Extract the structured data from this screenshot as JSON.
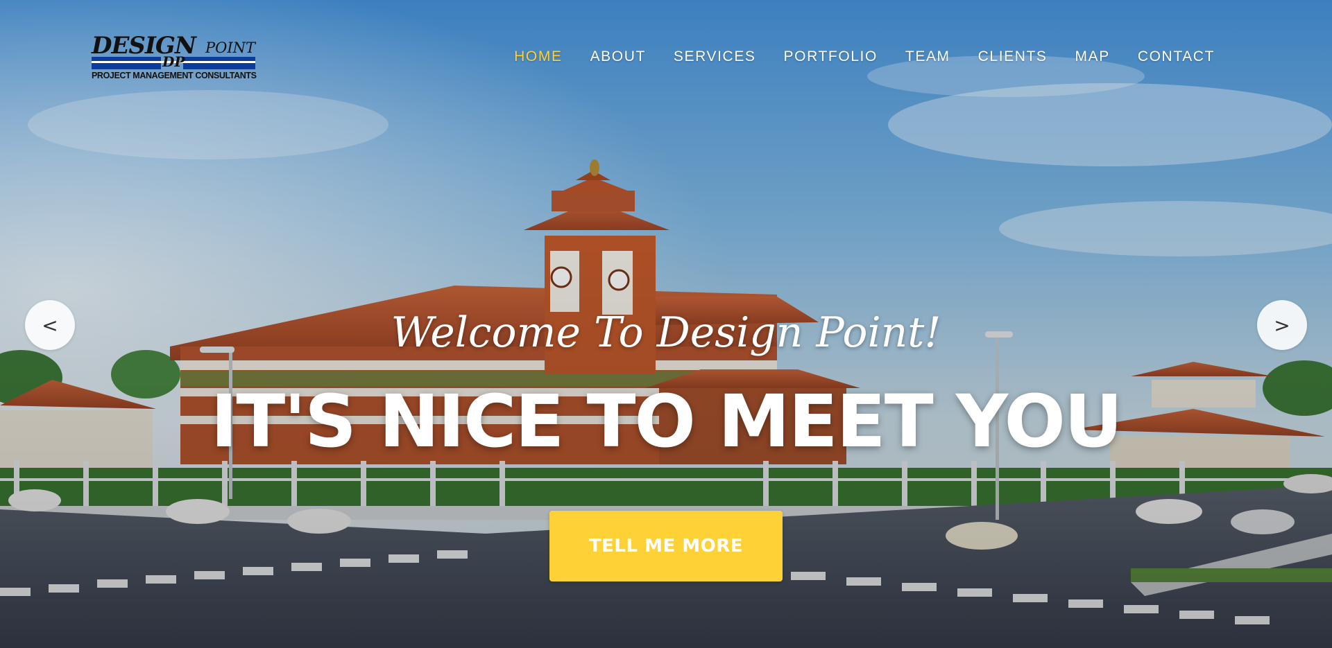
{
  "brand": {
    "logo_word": "DESIGN",
    "logo_point": "POINT",
    "logo_monogram": "DP",
    "logo_tagline": "PROJECT MANAGEMENT CONSULTANTS"
  },
  "nav": {
    "items": [
      {
        "label": "HOME",
        "active": true
      },
      {
        "label": "ABOUT",
        "active": false
      },
      {
        "label": "SERVICES",
        "active": false
      },
      {
        "label": "PORTFOLIO",
        "active": false
      },
      {
        "label": "TEAM",
        "active": false
      },
      {
        "label": "CLIENTS",
        "active": false
      },
      {
        "label": "MAP",
        "active": false
      },
      {
        "label": "CONTACT",
        "active": false
      }
    ]
  },
  "hero": {
    "lead_in": "Welcome To Design Point!",
    "heading": "IT'S NICE TO MEET YOU",
    "cta_label": "TELL ME MORE",
    "background_description_icon": "building-render-image"
  },
  "carousel": {
    "prev_label": "<",
    "next_label": ">"
  },
  "colors": {
    "accent": "#fed136",
    "logo_blue": "#0c3d9c",
    "nav_text": "#ffffff"
  }
}
